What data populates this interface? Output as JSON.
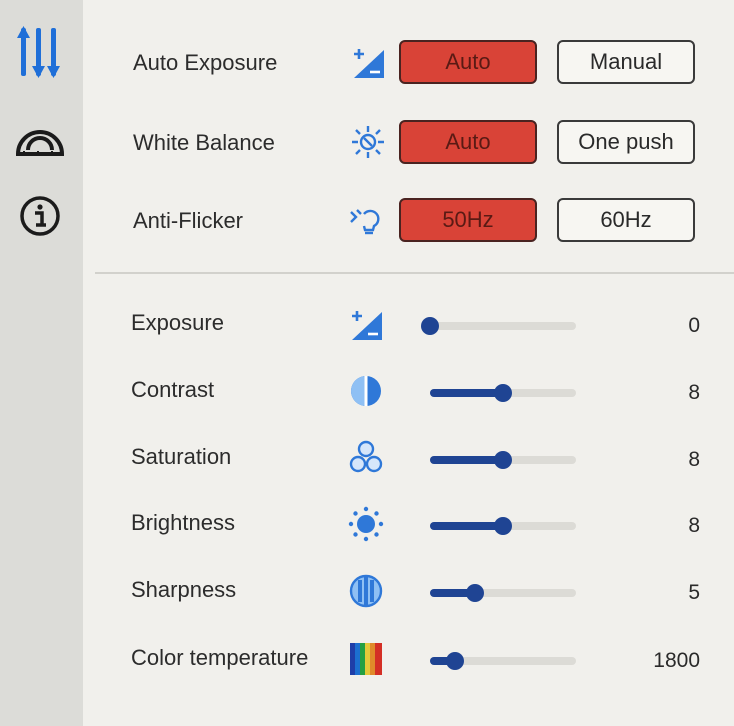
{
  "sidebar": {
    "items": [
      {
        "icon": "sliders-icon"
      },
      {
        "icon": "gauge-icon"
      },
      {
        "icon": "info-icon"
      }
    ]
  },
  "toggles": [
    {
      "label": "Auto Exposure",
      "icon": "exposure-icon",
      "options": [
        "Auto",
        "Manual"
      ],
      "selected": "Auto"
    },
    {
      "label": "White Balance",
      "icon": "white-balance-icon",
      "options": [
        "Auto",
        "One push"
      ],
      "selected": "Auto"
    },
    {
      "label": "Anti-Flicker",
      "icon": "anti-flicker-icon",
      "options": [
        "50Hz",
        "60Hz"
      ],
      "selected": "50Hz"
    }
  ],
  "sliders": [
    {
      "label": "Exposure",
      "icon": "exposure-icon",
      "value": "0",
      "level": 0.0
    },
    {
      "label": "Contrast",
      "icon": "contrast-icon",
      "value": "8",
      "level": 0.5
    },
    {
      "label": "Saturation",
      "icon": "saturation-icon",
      "value": "8",
      "level": 0.5
    },
    {
      "label": "Brightness",
      "icon": "brightness-icon",
      "value": "8",
      "level": 0.5
    },
    {
      "label": "Sharpness",
      "icon": "sharpness-icon",
      "value": "5",
      "level": 0.31
    },
    {
      "label": "Color temperature",
      "icon": "color-temperature-icon",
      "value": "1800",
      "level": 0.17
    }
  ],
  "colors": {
    "accent": "#d94337",
    "slider": "#1f4493",
    "icon_blue": "#2f78d8"
  }
}
